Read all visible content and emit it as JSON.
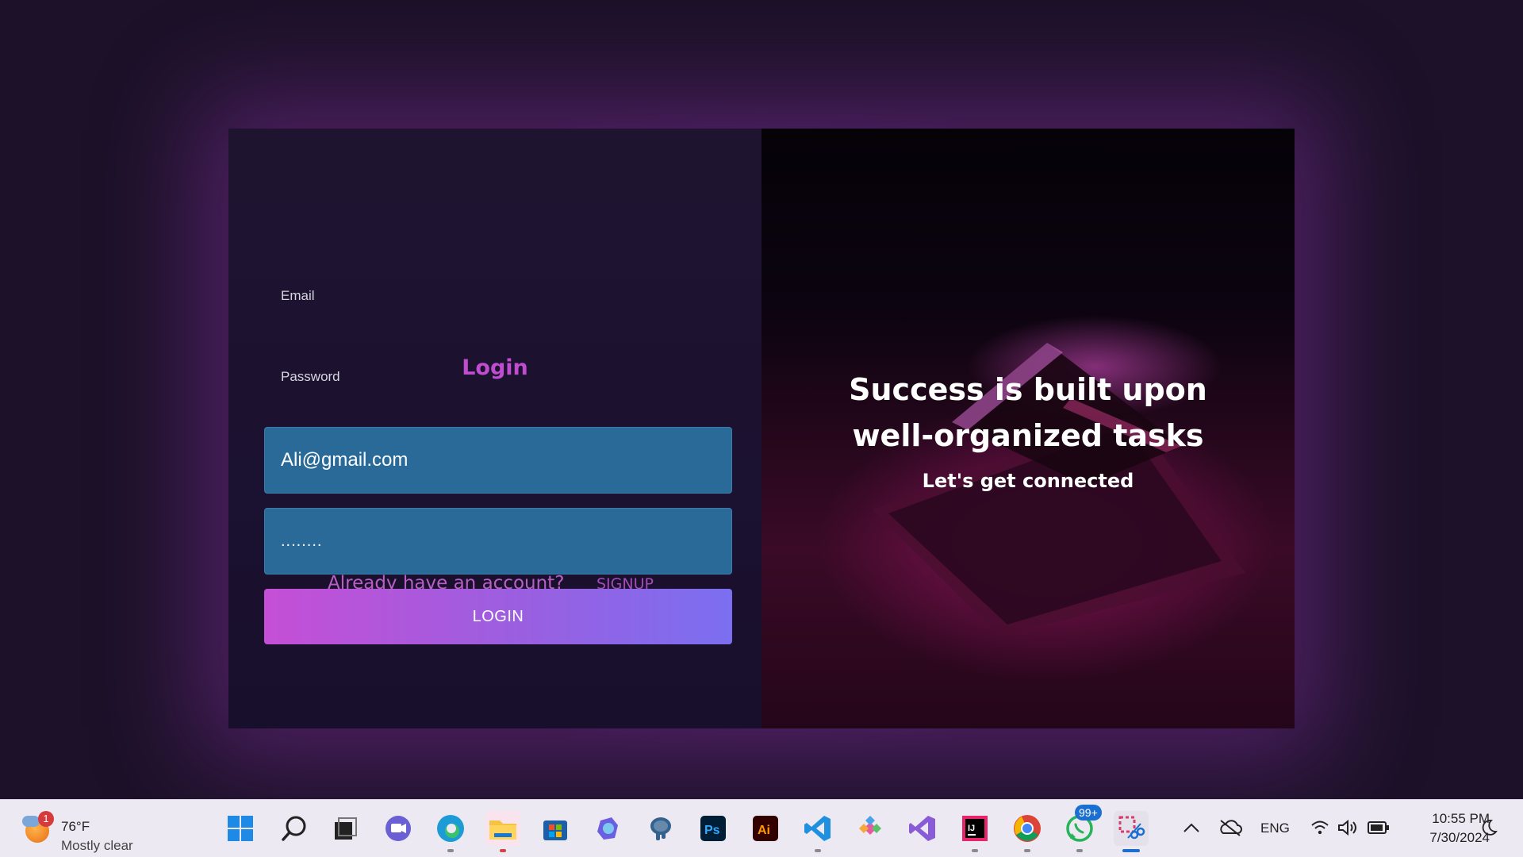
{
  "login": {
    "title": "Login",
    "email_label": "Email",
    "email_value": "Ali@gmail.com",
    "password_label": "Password",
    "password_value": "........",
    "button_label": "LOGIN",
    "account_text": "Already have an account?",
    "signup_label": "SIGNUP"
  },
  "hero": {
    "quote": "Success is built upon well-organized tasks",
    "subtitle": "Let's get connected"
  },
  "taskbar": {
    "weather_temp": "76°F",
    "weather_desc": "Mostly clear",
    "weather_badge": "1",
    "whatsapp_badge": "99+",
    "language": "ENG",
    "time": "10:55 PM",
    "date": "7/30/2024",
    "apps": [
      "start",
      "search",
      "task-view",
      "teams",
      "edge",
      "file-explorer",
      "microsoft-store",
      "copilot",
      "postgresql",
      "photoshop",
      "illustrator",
      "vscode",
      "git-client",
      "visual-studio",
      "intellij",
      "chrome",
      "whatsapp",
      "snipping-tool"
    ]
  },
  "colors": {
    "accent": "#c04dd0",
    "field_bg": "#2a6a98",
    "button_start": "#c54fd6",
    "button_end": "#7b6ff0"
  }
}
